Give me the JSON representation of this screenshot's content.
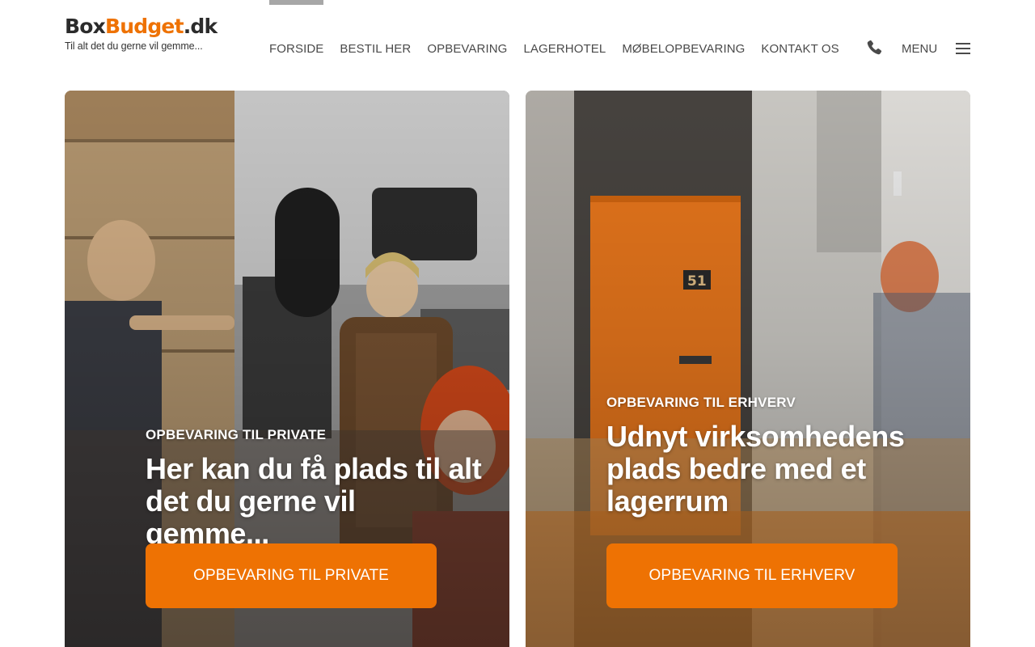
{
  "brand": {
    "logo_box": "Box",
    "logo_budget": "Budget",
    "logo_dk": ".dk",
    "tagline": "Til alt det du gerne vil gemme...",
    "accent_color": "#ee7203"
  },
  "nav": {
    "items": [
      {
        "label": "FORSIDE",
        "active": true
      },
      {
        "label": "BESTIL HER"
      },
      {
        "label": "OPBEVARING"
      },
      {
        "label": "LAGERHOTEL"
      },
      {
        "label": "MØBELOPBEVARING"
      },
      {
        "label": "KONTAKT OS"
      }
    ],
    "phone_icon": "phone-icon",
    "menu_label": "MENU",
    "menu_icon": "hamburger-icon"
  },
  "cards": [
    {
      "eyebrow": "OPBEVARING TIL PRIVATE",
      "title": "Her kan du få plads til alt det du gerne vil gemme...",
      "button": "OPBEVARING TIL PRIVATE"
    },
    {
      "eyebrow": "OPBEVARING TIL ERHVERV",
      "title": "Udnyt virksomhedens plads bedre med et lagerrum",
      "button": "OPBEVARING TIL ERHVERV",
      "door_number": "51"
    }
  ]
}
